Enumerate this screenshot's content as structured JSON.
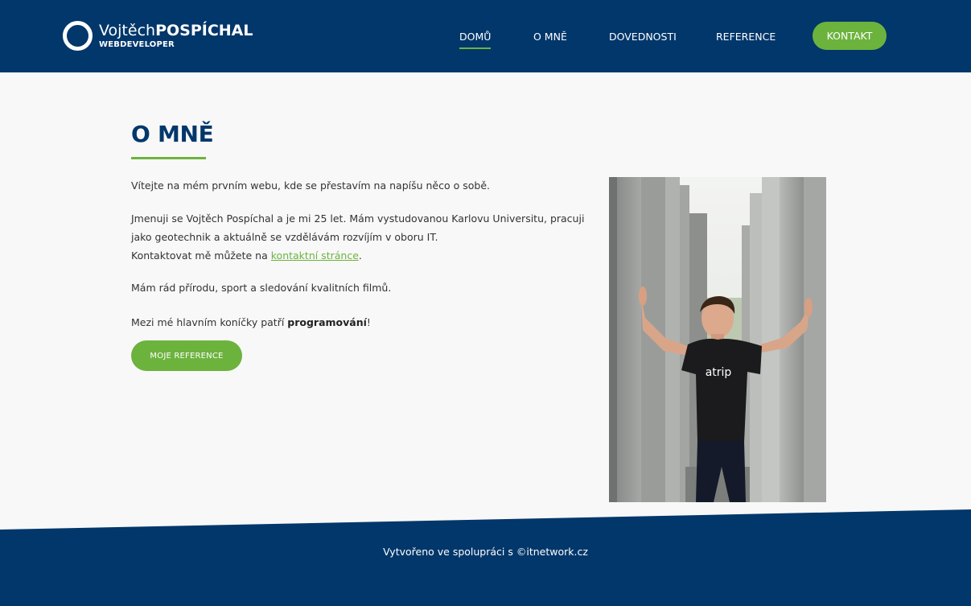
{
  "header": {
    "logo": {
      "name_first": "Vojtěch",
      "name_last": "POSPÍCHAL",
      "subtitle": "WEBDEVELOPER"
    },
    "nav": [
      {
        "label": "DOMŮ",
        "active": true
      },
      {
        "label": "O MNĚ",
        "active": false
      },
      {
        "label": "DOVEDNOSTI",
        "active": false
      },
      {
        "label": "REFERENCE",
        "active": false
      }
    ],
    "contact_label": "KONTAKT"
  },
  "main": {
    "title": "O MNĚ",
    "p1": "Vítejte na mém prvním webu, kde se přestavím na napíšu něco o sobě.",
    "p2_line1": "Jmenuji se Vojtěch Pospíchal a je mi 25 let. Mám vystudovanou Karlovu Universitu, pracuji",
    "p2_line2": "jako geotechnik a aktuálně se vzdělávám rozvíjím v oboru IT.",
    "p2_line3_pre": "Kontaktovat mě můžete na ",
    "p2_link": "kontaktní stránce",
    "p2_line3_post": ".",
    "p3": "Mám rád přírodu, sport a sledování kvalitních filmů.",
    "p4_pre": "Mezi mé hlavním koníčky patří ",
    "p4_bold": "programování",
    "p4_post": "!",
    "button_label": "MOJE REFERENCE",
    "photo_shirt_text": "atrip"
  },
  "footer": {
    "text": "Vytvořeno ve spolupráci s ©itnetwork.cz"
  },
  "colors": {
    "primary": "#02376b",
    "accent": "#6cb33e",
    "background": "#f8f8f8"
  }
}
